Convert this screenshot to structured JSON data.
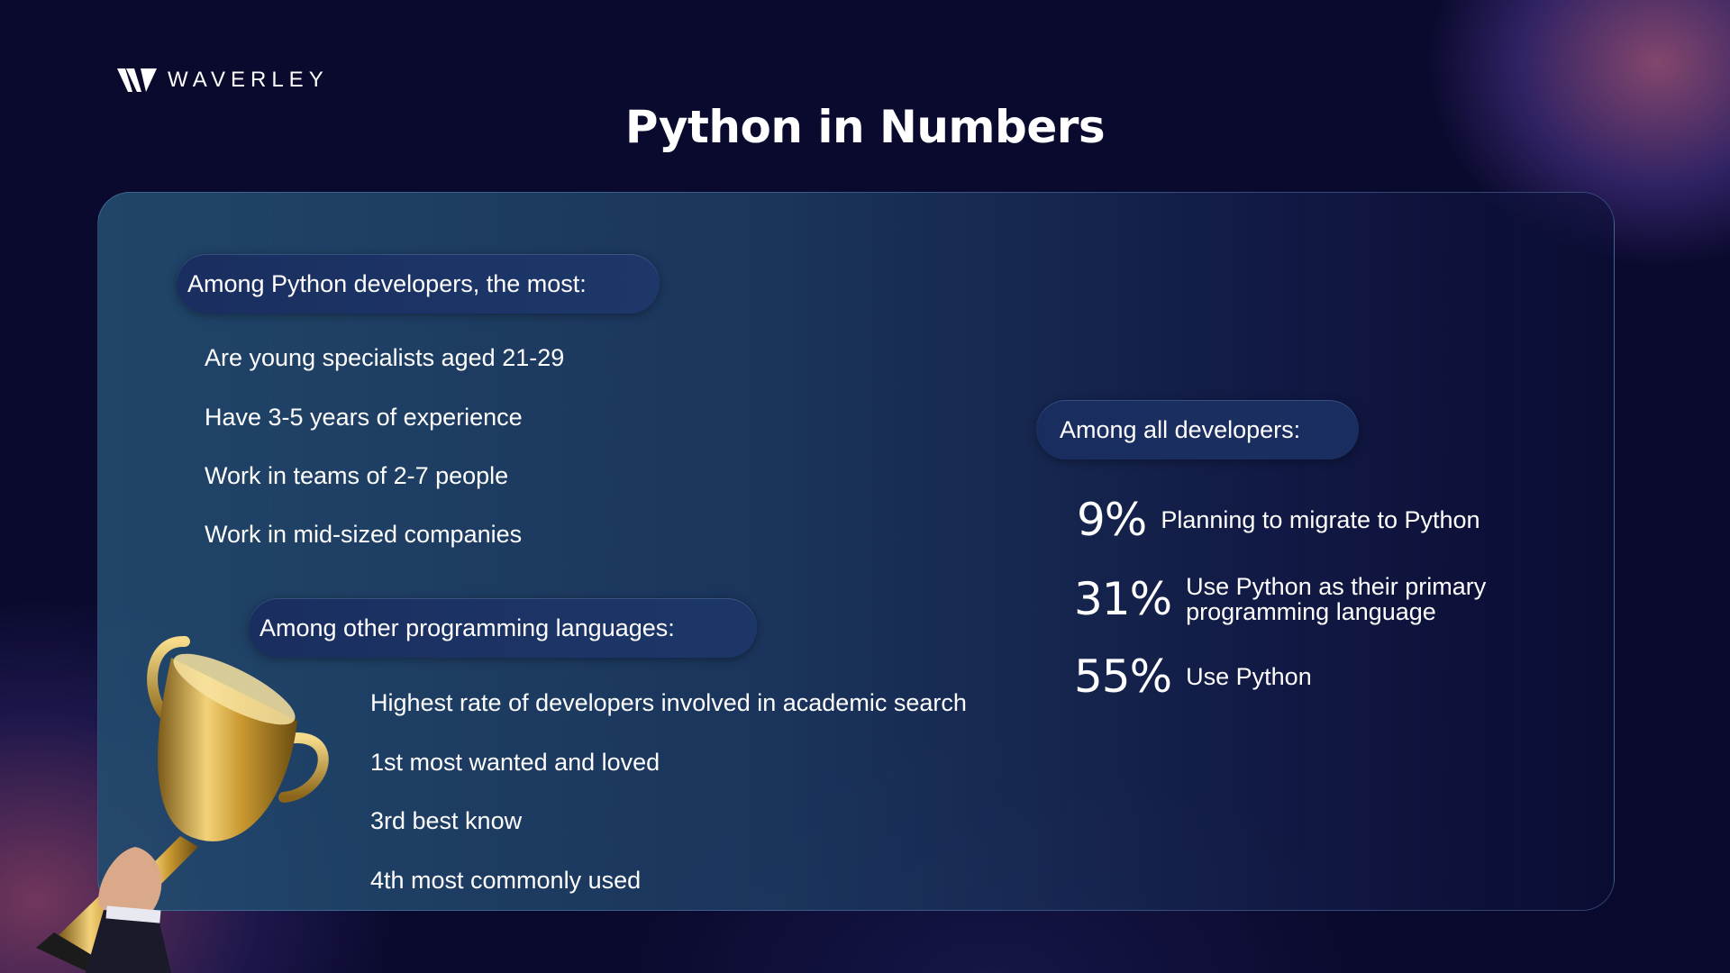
{
  "brand": {
    "name": "WAVERLEY",
    "logo_icon": "waverley-w-logo-icon"
  },
  "title": "Python in Numbers",
  "colors": {
    "background": "#0a0a2e",
    "panel": "#234b6e",
    "accent_glow": "#e678a0",
    "trophy_gold": "#d4a93a"
  },
  "python_developers": {
    "heading": "Among Python developers, the most:",
    "items": [
      "Are young specialists aged 21-29",
      "Have 3-5 years of experience",
      "Work in teams of 2-7 people",
      "Work in mid-sized companies"
    ]
  },
  "other_languages": {
    "heading": "Among other programming languages:",
    "items": [
      "Highest rate of developers involved in academic search",
      "1st most wanted and loved",
      "3rd best know",
      "4th most commonly used"
    ]
  },
  "all_developers": {
    "heading": "Among all developers:",
    "stats": [
      {
        "value": "9%",
        "label_line1": "Planning to migrate to Python",
        "label_line2": ""
      },
      {
        "value": "31%",
        "label_line1": "Use Python as their primary",
        "label_line2": "programming language"
      },
      {
        "value": "55%",
        "label_line1": "Use Python",
        "label_line2": ""
      }
    ]
  },
  "illustration": {
    "icon": "trophy-icon"
  }
}
